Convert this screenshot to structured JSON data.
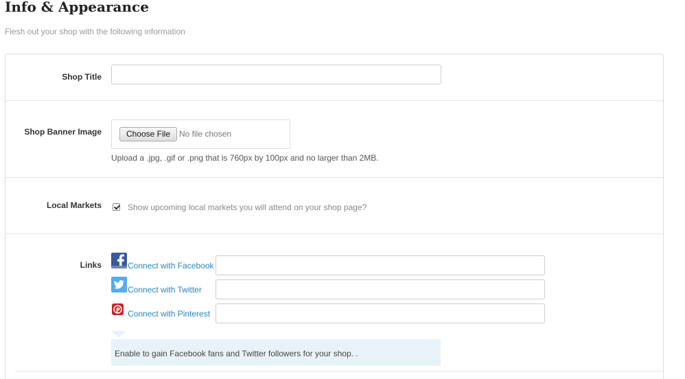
{
  "header": {
    "title": "Info & Appearance",
    "subtitle": "Flesh out your shop with the following information"
  },
  "shop_title": {
    "label": "Shop Title",
    "value": "",
    "placeholder": ""
  },
  "banner": {
    "label": "Shop Banner Image",
    "choose_button": "Choose File",
    "status": "No file chosen",
    "help": "Upload a .jpg, .gif or .png that is 760px by 100px and no larger than 2MB."
  },
  "local_markets": {
    "label": "Local Markets",
    "checked": true,
    "checkbox_label": "Show upcoming local markets you will attend on your shop page?"
  },
  "links": {
    "label": "Links",
    "items": [
      {
        "icon": "facebook-icon",
        "text": "Connect with Facebook",
        "value": ""
      },
      {
        "icon": "twitter-icon",
        "text": "Connect with Twitter",
        "value": ""
      },
      {
        "icon": "pinterest-icon",
        "text": "Connect with Pinterest",
        "value": ""
      }
    ],
    "info": "Enable to gain Facebook fans and Twitter followers for your shop. ."
  },
  "colors": {
    "facebook": "#3b5998",
    "twitter": "#55acee",
    "pinterest": "#cb2027",
    "link": "#2a86b8",
    "info_bg": "#e8f3f9"
  }
}
